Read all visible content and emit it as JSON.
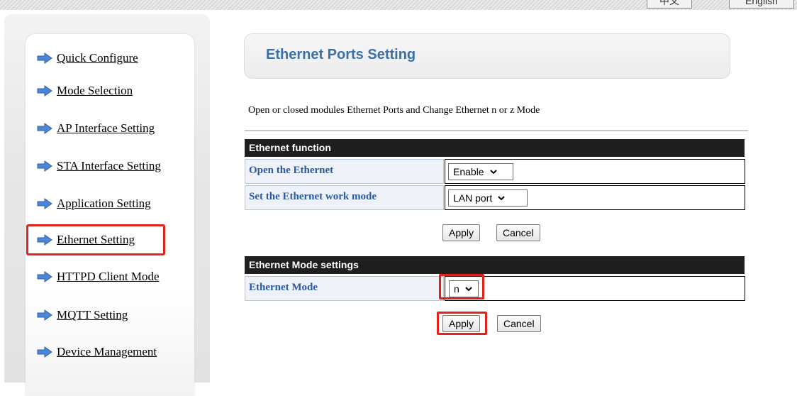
{
  "lang": {
    "chinese": "中文",
    "english": "English"
  },
  "sidebar": {
    "items": [
      {
        "label": "Quick Configure"
      },
      {
        "label": "Mode Selection"
      },
      {
        "label": "AP Interface Setting"
      },
      {
        "label": "STA Interface Setting"
      },
      {
        "label": "Application Setting"
      },
      {
        "label": "Ethernet Setting"
      },
      {
        "label": "HTTPD Client Mode"
      },
      {
        "label": "MQTT Setting"
      },
      {
        "label": "Device Management"
      }
    ],
    "active": "Ethernet Setting"
  },
  "main": {
    "title": "Ethernet Ports Setting",
    "description": "Open or closed modules Ethernet Ports and Change Ethernet n or z Mode",
    "function_section": {
      "header": "Ethernet function",
      "open_label": "Open the Ethernet",
      "open_value": "Enable",
      "mode_label": "Set the Ethernet work mode",
      "mode_value": "LAN port",
      "apply": "Apply",
      "cancel": "Cancel"
    },
    "mode_section": {
      "header": "Ethernet Mode settings",
      "mode_label": "Ethernet Mode",
      "mode_value": "n",
      "apply": "Apply",
      "cancel": "Cancel"
    }
  },
  "colors": {
    "accent_title": "#3a6fa8",
    "label_text": "#2b5aa1",
    "highlight": "#e2231a",
    "section_header": "#1f1f1f"
  },
  "icons": {
    "menu_bullet": "right-arrow-icon",
    "dropdown": "chevron-down-icon"
  }
}
